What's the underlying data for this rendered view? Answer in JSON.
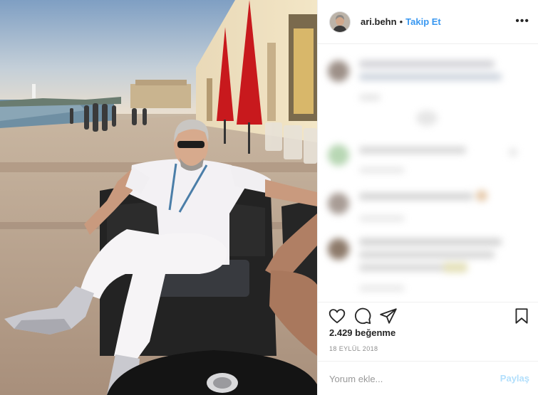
{
  "header": {
    "username": "ari.behn",
    "separator": "•",
    "follow_label": "Takip Et",
    "more_icon": "more-horizontal-icon"
  },
  "actions": {
    "like_icon": "heart-icon",
    "comment_icon": "comment-icon",
    "share_icon": "paper-plane-icon",
    "save_icon": "bookmark-icon"
  },
  "likes_text": "2.429 beğenme",
  "date_text": "18 EYLÜL 2018",
  "comment": {
    "placeholder": "Yorum ekle...",
    "post_label": "Paylaş"
  },
  "colors": {
    "link": "#3897f0",
    "post_disabled": "#b2dffc",
    "text": "#262626",
    "muted": "#8e8e8e"
  }
}
